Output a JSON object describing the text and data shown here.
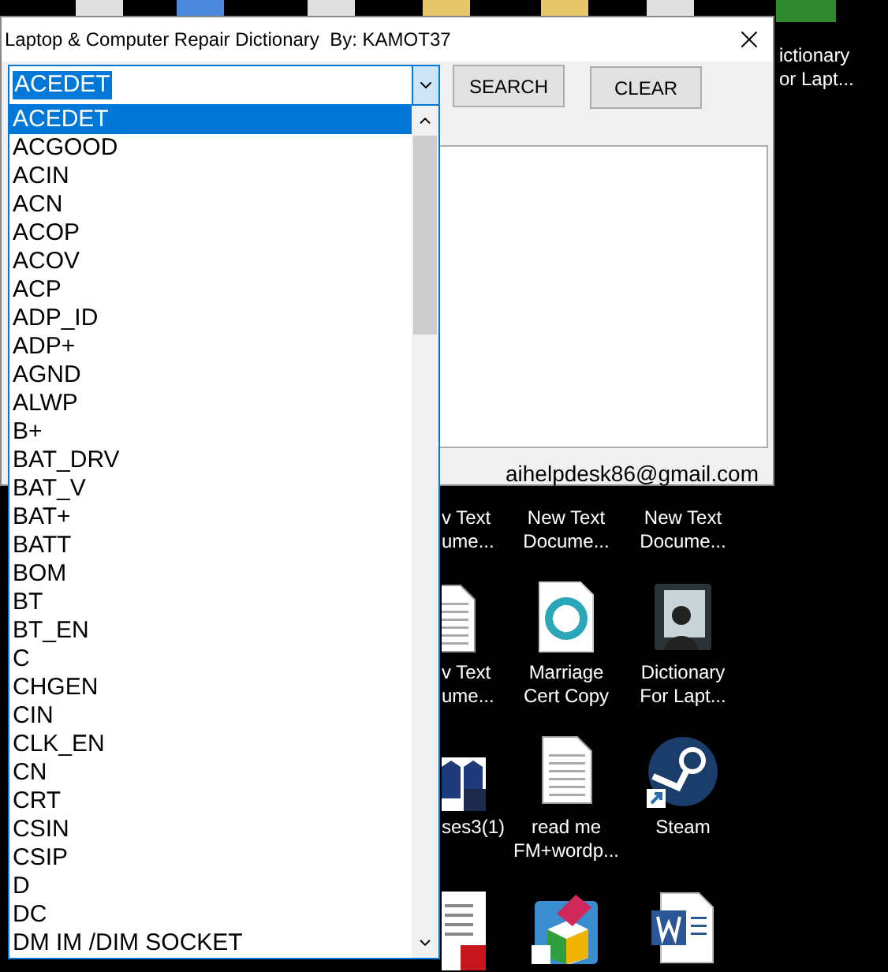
{
  "window": {
    "title": "Laptop & Computer Repair Dictionary  By: KAMOT37"
  },
  "combo": {
    "value": "ACEDET",
    "expanded": true
  },
  "buttons": [
    {
      "label": "SEARCH"
    },
    {
      "label": "CLEAR"
    }
  ],
  "contact": "aihelpdesk86@gmail.com",
  "list": [
    {
      "label": "ACEDET",
      "selected": true
    },
    {
      "label": "ACGOOD",
      "selected": false
    },
    {
      "label": "ACIN",
      "selected": false
    },
    {
      "label": "ACN",
      "selected": false
    },
    {
      "label": "ACOP",
      "selected": false
    },
    {
      "label": "ACOV",
      "selected": false
    },
    {
      "label": "ACP",
      "selected": false
    },
    {
      "label": "ADP_ID",
      "selected": false
    },
    {
      "label": "ADP+",
      "selected": false
    },
    {
      "label": "AGND",
      "selected": false
    },
    {
      "label": "ALWP",
      "selected": false
    },
    {
      "label": "B+",
      "selected": false
    },
    {
      "label": "BAT_DRV",
      "selected": false
    },
    {
      "label": "BAT_V",
      "selected": false
    },
    {
      "label": "BAT+",
      "selected": false
    },
    {
      "label": "BATT",
      "selected": false
    },
    {
      "label": "BOM",
      "selected": false
    },
    {
      "label": "BT",
      "selected": false
    },
    {
      "label": "BT_EN",
      "selected": false
    },
    {
      "label": "C",
      "selected": false
    },
    {
      "label": "CHGEN",
      "selected": false
    },
    {
      "label": "CIN",
      "selected": false
    },
    {
      "label": "CLK_EN",
      "selected": false
    },
    {
      "label": "CN",
      "selected": false
    },
    {
      "label": "CRT",
      "selected": false
    },
    {
      "label": "CSIN",
      "selected": false
    },
    {
      "label": "CSIP",
      "selected": false
    },
    {
      "label": "D",
      "selected": false
    },
    {
      "label": "DC",
      "selected": false
    },
    {
      "label": "DM IM /DIM SOCKET",
      "selected": false
    }
  ],
  "desktop": [
    {
      "kind": "none",
      "label_lines": [
        "ictionary",
        "or Lapt..."
      ]
    },
    {
      "kind": "none",
      "label_lines": [
        "v Text",
        "ume..."
      ]
    },
    {
      "kind": "none",
      "label_lines": [
        "New Text",
        "Docume..."
      ]
    },
    {
      "kind": "none",
      "label_lines": [
        "New Text",
        "Docume..."
      ]
    },
    {
      "kind": "text",
      "label_lines": [
        "v Text",
        "ume..."
      ]
    },
    {
      "kind": "app",
      "label_lines": [
        "Marriage",
        "Cert Copy"
      ]
    },
    {
      "kind": "photo",
      "label_lines": [
        "Dictionary",
        "For Lapt..."
      ]
    },
    {
      "kind": "psd",
      "label_lines": [
        "ses3(1)"
      ]
    },
    {
      "kind": "text",
      "label_lines": [
        "read me",
        "FM+wordp..."
      ]
    },
    {
      "kind": "steam",
      "label_lines": [
        "Steam"
      ]
    },
    {
      "kind": "pdf"
    },
    {
      "kind": "package"
    },
    {
      "kind": "word"
    }
  ]
}
